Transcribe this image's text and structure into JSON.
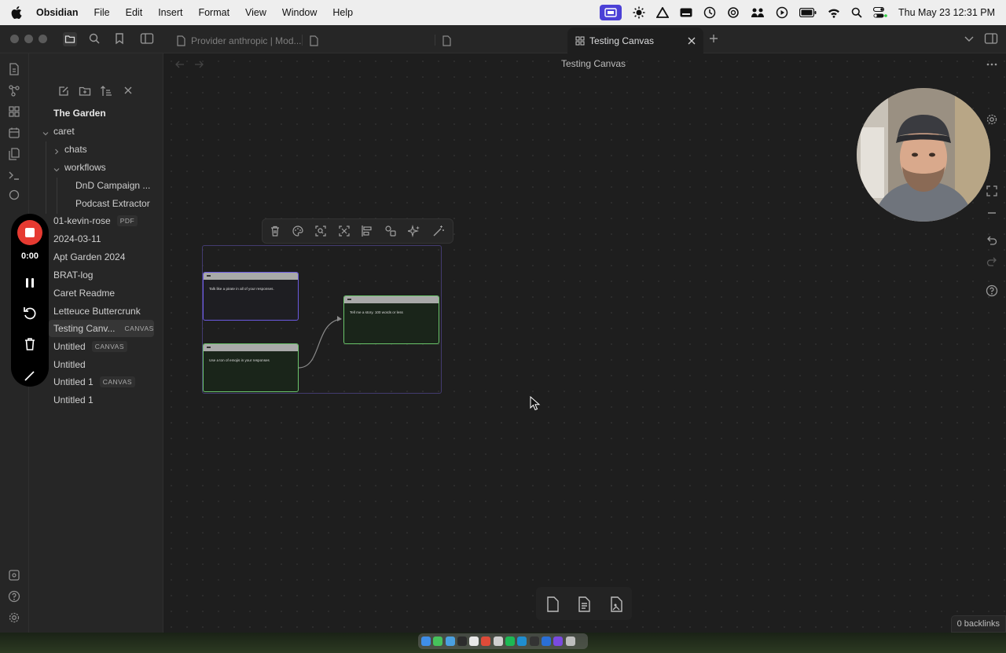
{
  "menubar": {
    "app_name": "Obsidian",
    "menus": [
      "File",
      "Edit",
      "Insert",
      "Format",
      "View",
      "Window",
      "Help"
    ],
    "datetime": "Thu May 23  12:31 PM"
  },
  "tabs": [
    {
      "label": "Provider anthropic | Mod...",
      "icon": "file-icon"
    },
    {
      "label": "",
      "icon": "file-icon"
    },
    {
      "label": "",
      "icon": "file-icon"
    },
    {
      "label": "Testing Canvas",
      "icon": "canvas-icon",
      "active": true
    }
  ],
  "sidebar": {
    "vault_name": "The Garden",
    "items": [
      {
        "label": "caret",
        "type": "folder-open"
      },
      {
        "label": "chats",
        "type": "folder-closed"
      },
      {
        "label": "workflows",
        "type": "folder-open"
      },
      {
        "label": "DnD Campaign ...",
        "type": "file"
      },
      {
        "label": "Podcast Extractor",
        "type": "file"
      },
      {
        "label": "01-kevin-rose",
        "type": "file",
        "badge": "PDF"
      },
      {
        "label": "2024-03-11",
        "type": "file"
      },
      {
        "label": "Apt Garden 2024",
        "type": "file"
      },
      {
        "label": "BRAT-log",
        "type": "file"
      },
      {
        "label": "Caret Readme",
        "type": "file"
      },
      {
        "label": "Letteuce Buttercrunk",
        "type": "file"
      },
      {
        "label": "Testing Canv...",
        "type": "file",
        "badge": "CANVAS",
        "active": true
      },
      {
        "label": "Untitled",
        "type": "file",
        "badge": "CANVAS"
      },
      {
        "label": "Untitled",
        "type": "file"
      },
      {
        "label": "Untitled 1",
        "type": "file",
        "badge": "CANVAS"
      },
      {
        "label": "Untitled 1",
        "type": "file"
      }
    ]
  },
  "recorder": {
    "elapsed": "0:00"
  },
  "main": {
    "title": "Testing Canvas",
    "nodes": [
      {
        "text": "Talk like a pirate in all of your responses.",
        "color": "#6b5ae0"
      },
      {
        "text": "Use a ton of emojis in your responses",
        "color": "#6bc66b"
      },
      {
        "text": "Tell me a story. 100 words or less",
        "color": "#6bc66b"
      }
    ],
    "backlinks": "0 backlinks"
  }
}
